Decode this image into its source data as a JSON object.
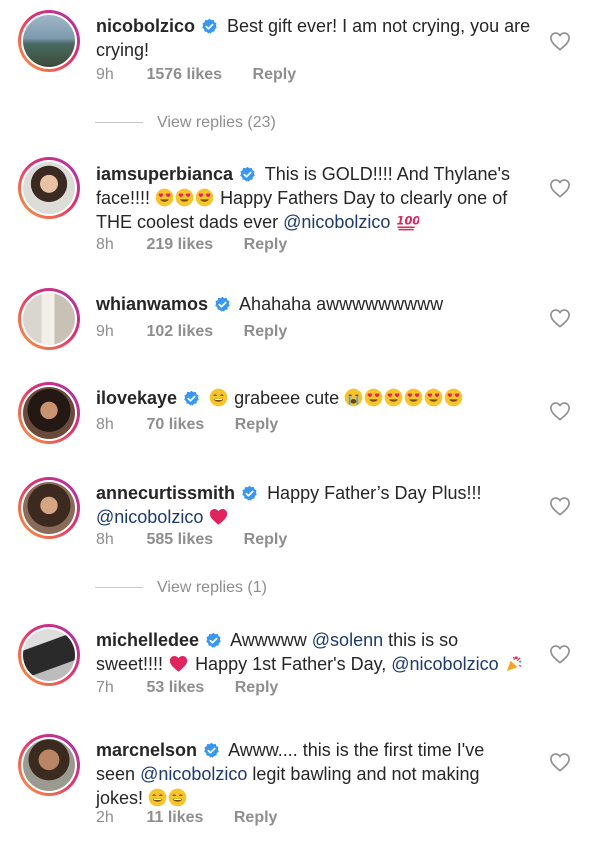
{
  "comments": [
    {
      "username": "nicobolzico",
      "verified": true,
      "text_line1": "Best gift ever! I am not crying, you are",
      "text_line2": "crying!",
      "time": "9h",
      "likes": "1576 likes",
      "reply": "Reply",
      "view_replies": "View replies (23)"
    },
    {
      "username": "iamsuperbianca",
      "verified": true,
      "text_line1": "This is GOLD!!!! And Thylane's",
      "text_line2a": "face!!!!",
      "text_line2b": "Happy Fathers Day to clearly one of",
      "text_line3a": "THE coolest dads ever",
      "mention": "@nicobolzico",
      "time": "8h",
      "likes": "219 likes",
      "reply": "Reply"
    },
    {
      "username": "whianwamos",
      "verified": true,
      "text_line1": "Ahahaha awwwwwwwww",
      "time": "9h",
      "likes": "102 likes",
      "reply": "Reply"
    },
    {
      "username": "ilovekaye",
      "verified": true,
      "text_line1": "grabeee cute",
      "time": "8h",
      "likes": "70 likes",
      "reply": "Reply"
    },
    {
      "username": "annecurtissmith",
      "verified": true,
      "text_line1": "Happy Father’s Day Plus!!!",
      "mention": "@nicobolzico",
      "time": "8h",
      "likes": "585 likes",
      "reply": "Reply",
      "view_replies": "View replies (1)"
    },
    {
      "username": "michelledee",
      "verified": true,
      "text_line1a": "Awwwww",
      "mention1": "@solenn",
      "text_line1b": "this is so",
      "text_line2a": "sweet!!!!",
      "text_line2b": "Happy 1st Father's Day,",
      "mention2": "@nicobolzico",
      "time": "7h",
      "likes": "53 likes",
      "reply": "Reply"
    },
    {
      "username": "marcnelson",
      "verified": true,
      "text_line1": "Awww.... this is the first time I've",
      "text_line2a": "seen",
      "mention": "@nicobolzico",
      "text_line2b": "legit bawling and not making",
      "text_line3": "jokes!",
      "time": "2h",
      "likes": "11 likes",
      "reply": "Reply"
    }
  ],
  "icons": {
    "verified_color": "#3897f0",
    "heart_color": "#8e8e8e",
    "ring_gradient": [
      "#f9a13a",
      "#e1306c",
      "#a234b5"
    ]
  }
}
